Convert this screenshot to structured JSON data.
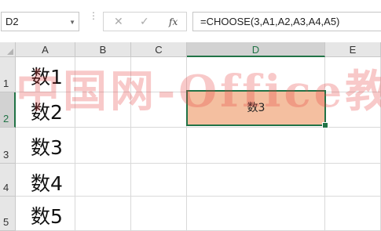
{
  "name_box": {
    "value": "D2"
  },
  "formula_bar": {
    "cancel_icon": "✕",
    "enter_icon": "✓",
    "fx_label": "fx",
    "formula": "=CHOOSE(3,A1,A2,A3,A4,A5)"
  },
  "columns": [
    "A",
    "B",
    "C",
    "D",
    "E"
  ],
  "rows": [
    "1",
    "2",
    "3",
    "4",
    "5"
  ],
  "cells": {
    "A1": "数1",
    "A2": "数2",
    "A3": "数3",
    "A4": "数4",
    "A5": "数5",
    "D2": "数3"
  },
  "selected": {
    "cell": "D2",
    "column": "D",
    "row": "2"
  },
  "colors": {
    "accent": "#217346",
    "selection_fill": "#f4bfa0",
    "watermark": "#e63c3c"
  },
  "watermark": "中国网-Office教程网"
}
